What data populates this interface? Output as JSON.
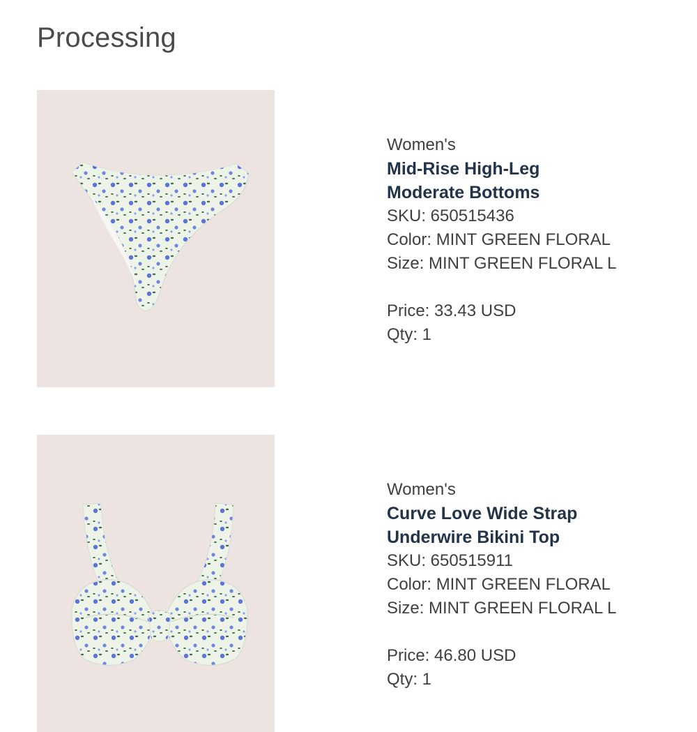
{
  "page": {
    "title": "Processing"
  },
  "items": [
    {
      "gender": "Women's",
      "name_line1": "Mid-Rise High-Leg",
      "name_line2": "Moderate Bottoms",
      "sku": "SKU: 650515436",
      "color": "Color: MINT GREEN FLORAL",
      "size": "Size: MINT GREEN FLORAL L",
      "price": "Price: 33.43 USD",
      "qty": "Qty: 1",
      "image_icon": "floral-bikini-bottom-image"
    },
    {
      "gender": "Women's",
      "name_line1": "Curve Love Wide Strap",
      "name_line2": "Underwire Bikini Top",
      "sku": "SKU: 650515911",
      "color": "Color: MINT GREEN FLORAL",
      "size": "Size: MINT GREEN FLORAL L",
      "price": "Price: 46.80 USD",
      "qty": "Qty: 1",
      "image_icon": "floral-bikini-top-image"
    }
  ],
  "colors": {
    "thumb_background": "#ede4e2",
    "product_name": "#22334a",
    "fabric_base": "#eef3e8",
    "flower_blue": "#5b74d6",
    "leaf_green": "#3f6b4a"
  }
}
